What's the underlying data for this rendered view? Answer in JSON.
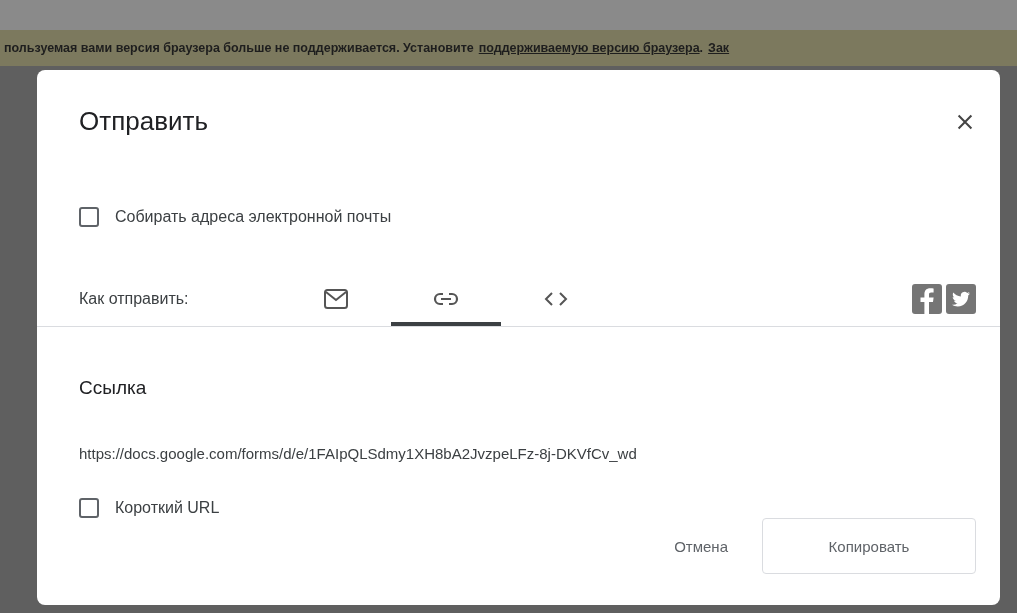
{
  "banner": {
    "text": "пользуемая вами версия браузера больше не поддерживается. Установите",
    "link": "поддерживаемую версию браузера",
    "after": ".",
    "trailing_link": "Зак"
  },
  "dialog": {
    "title": "Отправить",
    "collect_emails": {
      "label": "Собирать адреса электронной почты",
      "checked": false
    },
    "send_via": {
      "label": "Как отправить:",
      "tabs": [
        {
          "kind": "email",
          "selected": false
        },
        {
          "kind": "link",
          "selected": true
        },
        {
          "kind": "embed",
          "selected": false
        }
      ],
      "share": [
        {
          "kind": "facebook"
        },
        {
          "kind": "twitter"
        }
      ]
    },
    "section_title": "Ссылка",
    "url": "https://docs.google.com/forms/d/e/1FAIpQLSdmy1XH8bA2JvzpeLFz-8j-DKVfCv_wd",
    "short_url": {
      "label": "Короткий URL",
      "checked": false
    },
    "buttons": {
      "cancel": "Отмена",
      "copy": "Копировать"
    }
  }
}
